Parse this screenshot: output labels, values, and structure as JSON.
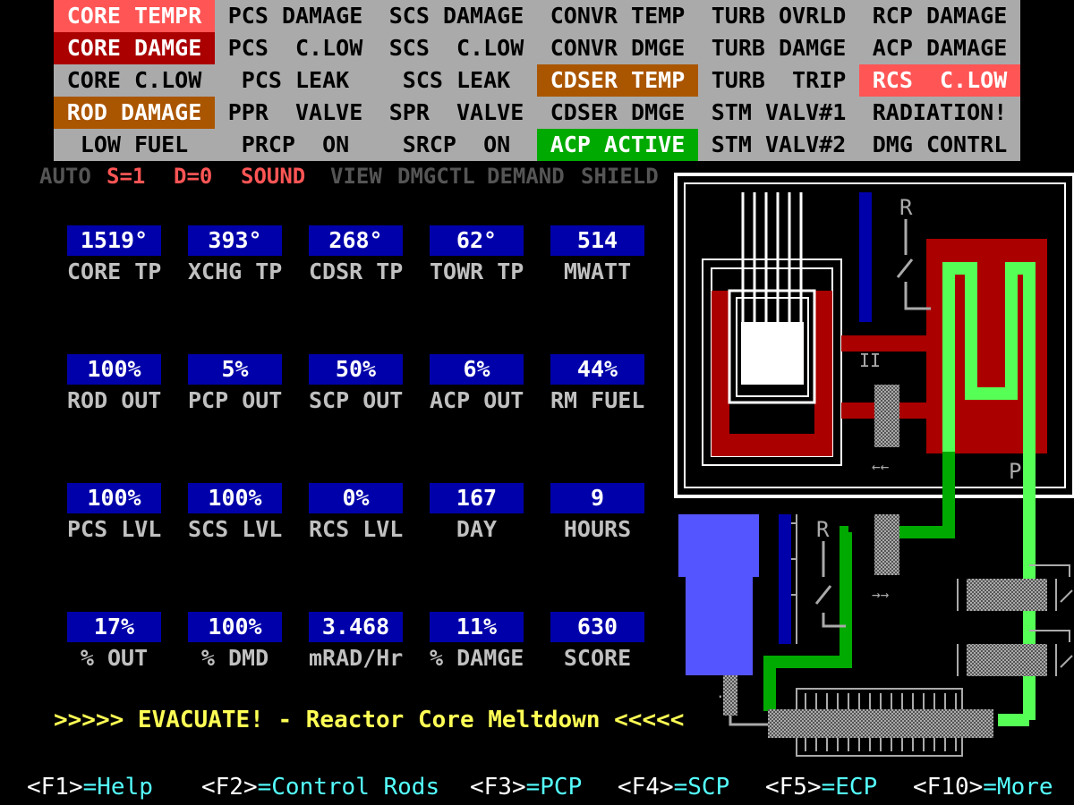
{
  "status_grid": [
    [
      {
        "label": "CORE TEMPR",
        "state": "alarm-light"
      },
      {
        "label": "PCS DAMAGE",
        "state": "normal"
      },
      {
        "label": "SCS DAMAGE",
        "state": "normal"
      },
      {
        "label": "CONVR TEMP",
        "state": "normal"
      },
      {
        "label": "TURB OVRLD",
        "state": "normal"
      },
      {
        "label": "RCP DAMAGE",
        "state": "normal"
      }
    ],
    [
      {
        "label": "CORE DAMGE",
        "state": "alarm-dark"
      },
      {
        "label": "PCS  C.LOW",
        "state": "normal"
      },
      {
        "label": "SCS  C.LOW",
        "state": "normal"
      },
      {
        "label": "CONVR DMGE",
        "state": "normal"
      },
      {
        "label": "TURB DAMGE",
        "state": "normal"
      },
      {
        "label": "ACP DAMAGE",
        "state": "normal"
      }
    ],
    [
      {
        "label": "CORE C.LOW",
        "state": "normal"
      },
      {
        "label": "PCS LEAK",
        "state": "normal"
      },
      {
        "label": "SCS LEAK",
        "state": "normal"
      },
      {
        "label": "CDSER TEMP",
        "state": "warning"
      },
      {
        "label": "TURB  TRIP",
        "state": "normal"
      },
      {
        "label": "RCS  C.LOW",
        "state": "alarm-light"
      }
    ],
    [
      {
        "label": "ROD DAMAGE",
        "state": "warning"
      },
      {
        "label": "PPR  VALVE",
        "state": "normal"
      },
      {
        "label": "SPR  VALVE",
        "state": "normal"
      },
      {
        "label": "CDSER DMGE",
        "state": "normal"
      },
      {
        "label": "STM VALV#1",
        "state": "normal"
      },
      {
        "label": "RADIATION!",
        "state": "normal"
      }
    ],
    [
      {
        "label": "LOW FUEL",
        "state": "normal"
      },
      {
        "label": "PRCP  ON",
        "state": "normal"
      },
      {
        "label": "SRCP  ON",
        "state": "normal"
      },
      {
        "label": "ACP ACTIVE",
        "state": "active"
      },
      {
        "label": "STM VALV#2",
        "state": "normal"
      },
      {
        "label": "DMG CONTRL",
        "state": "normal"
      }
    ]
  ],
  "state_colors": {
    "normal": "#aaaaaa",
    "alarm-light": "#ff5555",
    "alarm-dark": "#aa0000",
    "warning": "#aa5500",
    "active": "#00aa00"
  },
  "mode_bar": [
    {
      "label": "AUTO",
      "color": "#555555"
    },
    {
      "label": "S=1",
      "color": "#ff5555"
    },
    {
      "label": "D=0",
      "color": "#ff5555"
    },
    {
      "label": "SOUND",
      "color": "#ff5555"
    },
    {
      "label": "VIEW",
      "color": "#555555"
    },
    {
      "label": "DMGCTL",
      "color": "#555555"
    },
    {
      "label": "DEMAND",
      "color": "#555555"
    },
    {
      "label": "SHIELD",
      "color": "#555555"
    }
  ],
  "readings": [
    [
      {
        "value": "1519°",
        "label": "CORE TP"
      },
      {
        "value": "393°",
        "label": "XCHG TP"
      },
      {
        "value": "268°",
        "label": "CDSR TP"
      },
      {
        "value": "62°",
        "label": "TOWR TP"
      },
      {
        "value": "514",
        "label": "MWATT"
      }
    ],
    [
      {
        "value": "100%",
        "label": "ROD OUT"
      },
      {
        "value": "5%",
        "label": "PCP OUT"
      },
      {
        "value": "50%",
        "label": "SCP OUT"
      },
      {
        "value": "6%",
        "label": "ACP OUT"
      },
      {
        "value": "44%",
        "label": "RM FUEL"
      }
    ],
    [
      {
        "value": "100%",
        "label": "PCS LVL"
      },
      {
        "value": "100%",
        "label": "SCS LVL"
      },
      {
        "value": "0%",
        "label": "RCS LVL"
      },
      {
        "value": "167",
        "label": "DAY"
      },
      {
        "value": "9",
        "label": "HOURS"
      }
    ],
    [
      {
        "value": "17%",
        "label": "% OUT"
      },
      {
        "value": "100%",
        "label": "% DMD"
      },
      {
        "value": "3.468",
        "label": "mRAD/Hr"
      },
      {
        "value": "11%",
        "label": "% DAMGE"
      },
      {
        "value": "630",
        "label": "SCORE"
      }
    ]
  ],
  "alarm_message": ">>>>> EVACUATE! - Reactor Core Meltdown <<<<<",
  "function_keys": [
    {
      "key": "<F1>",
      "action": "=Help"
    },
    {
      "key": "<F2>",
      "action": "=Control Rods"
    },
    {
      "key": "<F3>",
      "action": "=PCP"
    },
    {
      "key": "<F4>",
      "action": "=SCP"
    },
    {
      "key": "<F5>",
      "action": "=ECP"
    },
    {
      "key": "<F10>",
      "action": "=More"
    }
  ],
  "diagram": {
    "label_r1": "R",
    "label_r2": "R",
    "label_p": "P",
    "label_ii": "II",
    "arrow_left": "←←",
    "arrow_right": "→→"
  }
}
